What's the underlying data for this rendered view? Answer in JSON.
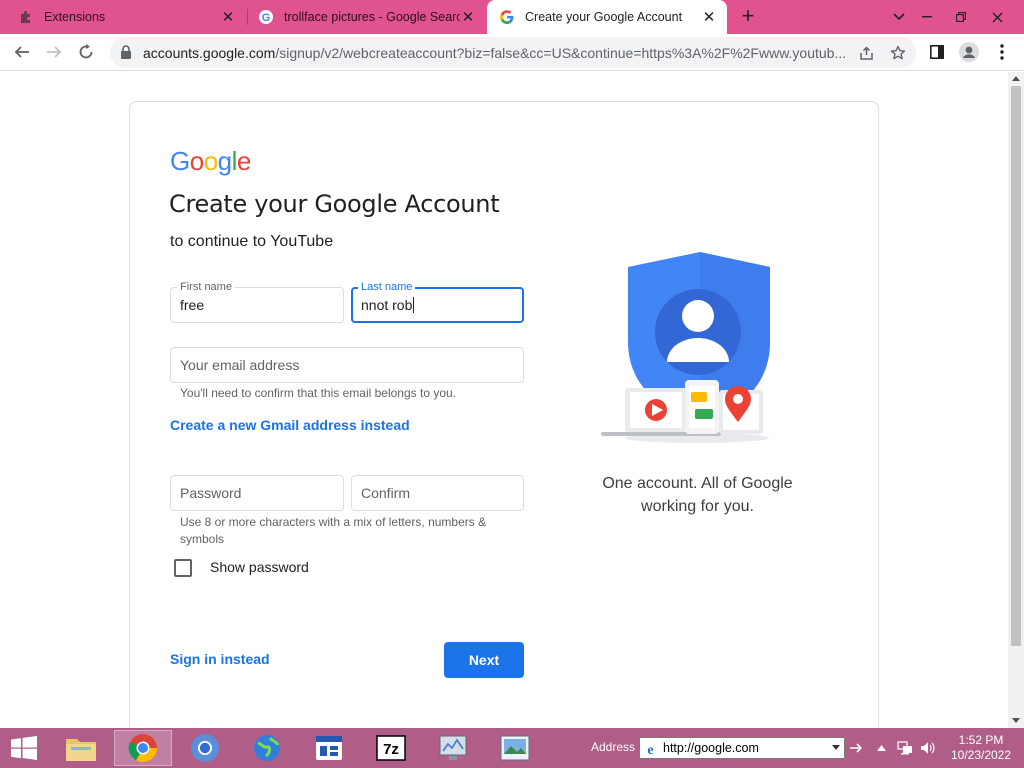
{
  "browser": {
    "tabs": [
      {
        "label": "Extensions",
        "icon": "puzzle-icon"
      },
      {
        "label": "trollface pictures - Google Search",
        "icon": "google-g-icon"
      },
      {
        "label": "Create your Google Account",
        "icon": "google-g-icon"
      }
    ],
    "url_host": "accounts.google.com",
    "url_rest": "/signup/v2/webcreateaccount?biz=false&cc=US&continue=https%3A%2F%2Fwww.youtub...",
    "close_glyph": "✕",
    "newtab_glyph": "+"
  },
  "page": {
    "logo": [
      "G",
      "o",
      "o",
      "g",
      "l",
      "e"
    ],
    "logo_colors": [
      "#4285f4",
      "#ea4335",
      "#fbbc05",
      "#4285f4",
      "#34a853",
      "#ea4335"
    ],
    "title": "Create your Google Account",
    "subtitle": "to continue to YouTube",
    "first_name": {
      "label": "First name",
      "value": "free"
    },
    "last_name": {
      "label": "Last name",
      "value": "nnot rob"
    },
    "email": {
      "placeholder": "Your email address",
      "hint": "You'll need to confirm that this email belongs to you."
    },
    "gmail_link": "Create a new Gmail address instead",
    "password": {
      "placeholder": "Password"
    },
    "confirm": {
      "placeholder": "Confirm"
    },
    "password_hint": "Use 8 or more characters with a mix of letters, numbers & symbols",
    "show_password": "Show password",
    "signin_link": "Sign in instead",
    "next_button": "Next",
    "tagline_line1": "One account. All of Google",
    "tagline_line2": "working for you."
  },
  "colors": {
    "accent": "#1a73e8",
    "tabstrip": "#e0538f",
    "taskbar": "#b05d88"
  },
  "taskbar": {
    "address_label": "Address",
    "address_value": "http://google.com",
    "time": "1:52 PM",
    "date": "10/23/2022"
  }
}
